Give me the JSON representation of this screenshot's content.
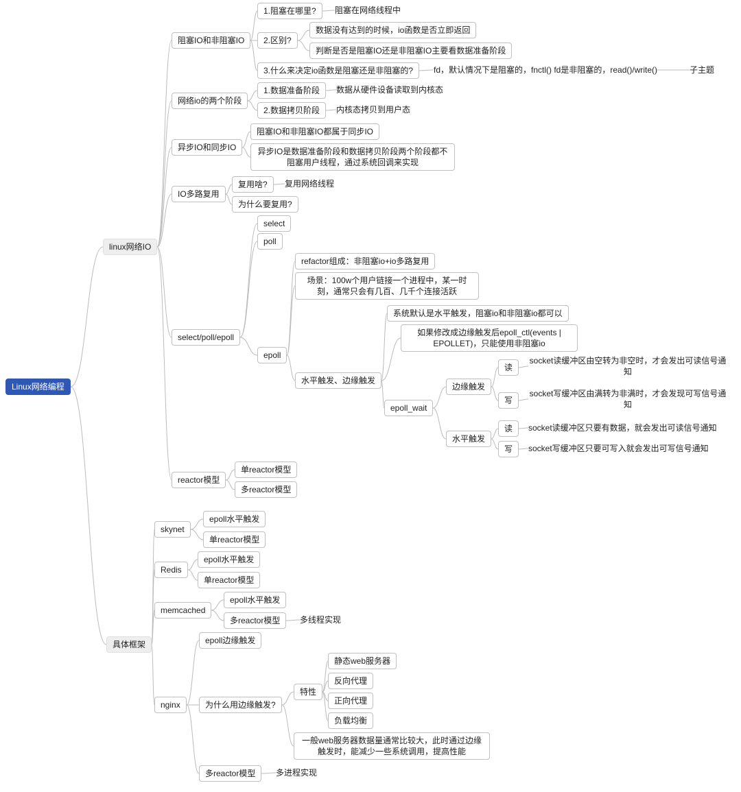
{
  "root": "Linux网络编程",
  "l1": {
    "a": "linux网络IO",
    "b": "具体框架"
  },
  "io": {
    "block": {
      "t": "阻塞IO和非阻塞IO",
      "q1": "1.阻塞在哪里?",
      "a1": "阻塞在网络线程中",
      "q2": "2.区别?",
      "a2a": "数据没有达到的时候，io函数是否立即返回",
      "a2b": "判断是否是阻塞IO还是非阻塞IO主要看数据准备阶段",
      "q3": "3.什么来决定io函数是阻塞还是非阻塞的?",
      "a3": "fd，默认情况下是阻塞的，fnctl() fd是非阻塞的，read()/write()",
      "a3s": "子主题"
    },
    "two": {
      "t": "网络io的两个阶段",
      "p1": "1.数据准备阶段",
      "p1d": "数据从硬件设备读取到内核态",
      "p2": "2.数据拷贝阶段",
      "p2d": "内核态拷贝到用户态"
    },
    "sync": {
      "t": "异步IO和同步IO",
      "a": "阻塞IO和非阻塞IO都属于同步IO",
      "b": "异步IO是数据准备阶段和数据拷贝阶段两个阶段都不阻塞用户线程，通过系统回调来实现"
    },
    "mux": {
      "t": "IO多路复用",
      "q1": "复用啥?",
      "a1": "复用网络线程",
      "q2": "为什么要复用?"
    },
    "spe": {
      "t": "select/poll/epoll",
      "sel": "select",
      "pol": "poll",
      "ep": "epoll",
      "r1": "refactor组成：非阻塞io+io多路复用",
      "r2": "场景：100w个用户链接一个进程中，某一时刻，通常只会有几百、几千个连接活跃",
      "trig": "水平触发、边缘触发",
      "d1": "系统默认是水平触发，阻塞io和非阻塞io都可以",
      "d2": "如果修改成边缘触发后epoll_ctl(events | EPOLLET)，只能使用非阻塞io",
      "ew": "epoll_wait",
      "edge": "边缘触发",
      "lev": "水平触发",
      "rd": "读",
      "wr": "写",
      "er": "socket读缓冲区由空转为非空时，才会发出可读信号通知",
      "ewr": "socket写缓冲区由满转为非满时，才会发现可写信号通知",
      "lr": "socket读缓冲区只要有数据，就会发出可读信号通知",
      "lw": "socket写缓冲区只要可写入就会发出可写信号通知"
    },
    "reactor": {
      "t": "reactor模型",
      "a": "单reactor模型",
      "b": "多reactor模型"
    }
  },
  "fw": {
    "skynet": {
      "t": "skynet",
      "a": "epoll水平触发",
      "b": "单reactor模型"
    },
    "redis": {
      "t": "Redis",
      "a": "epoll水平触发",
      "b": "单reactor模型"
    },
    "memc": {
      "t": "memcached",
      "a": "epoll水平触发",
      "b": "多reactor模型",
      "c": "多线程实现"
    },
    "nginx": {
      "t": "nginx",
      "a": "epoll边缘触发",
      "why": "为什么用边缘触发?",
      "feat": "特性",
      "f1": "静态web服务器",
      "f2": "反向代理",
      "f3": "正向代理",
      "f4": "负载均衡",
      "note": "一般web服务器数据量通常比较大，此时通过边缘触发时，能减少一些系统调用，提高性能",
      "mr": "多reactor模型",
      "mp": "多进程实现"
    }
  }
}
